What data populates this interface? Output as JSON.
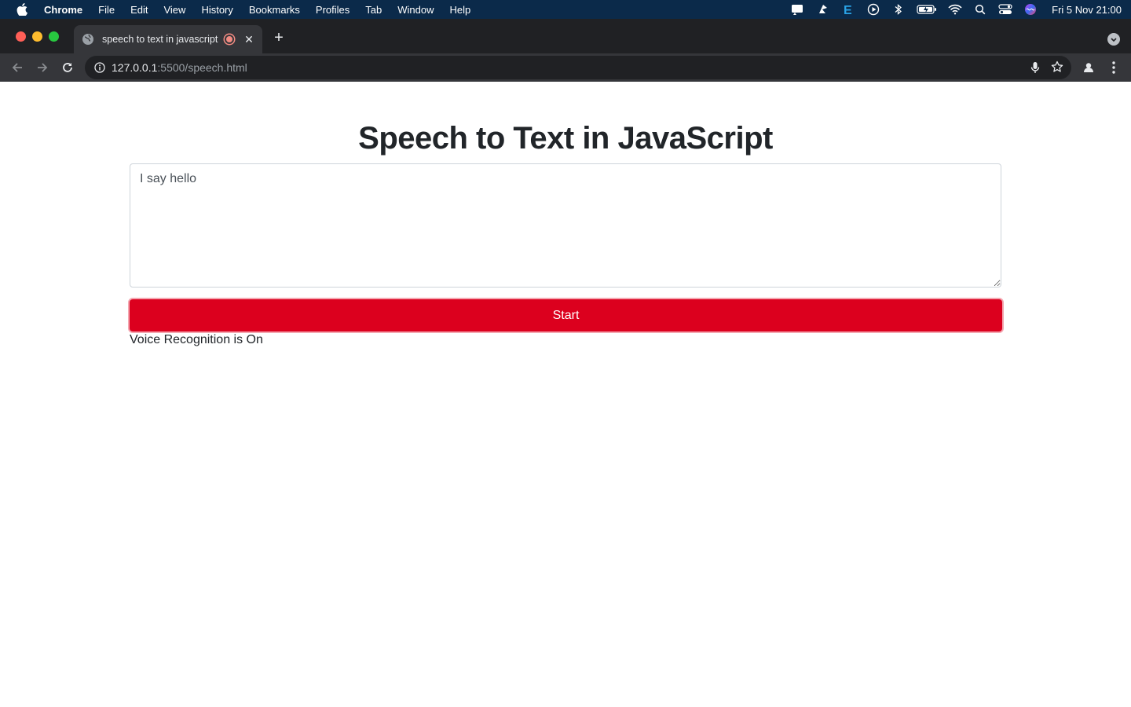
{
  "menubar": {
    "app_name": "Chrome",
    "items": [
      "File",
      "Edit",
      "View",
      "History",
      "Bookmarks",
      "Profiles",
      "Tab",
      "Window",
      "Help"
    ],
    "clock": "Fri 5 Nov  21:00",
    "status_icons": [
      "notification-icon",
      "launcher-icon",
      "evernote-icon",
      "play-icon",
      "bluetooth-icon",
      "battery-icon",
      "wifi-icon",
      "spotlight-icon",
      "control-center-icon",
      "siri-icon"
    ]
  },
  "browser": {
    "tab_title": "speech to text in javascript",
    "url_host": "127.0.0.1",
    "url_path": ":5500/speech.html"
  },
  "page": {
    "heading": "Speech to Text in JavaScript",
    "textarea_value": "I say hello",
    "button_label": "Start",
    "status_text": "Voice Recognition is On",
    "accent_color": "#dc001e"
  }
}
